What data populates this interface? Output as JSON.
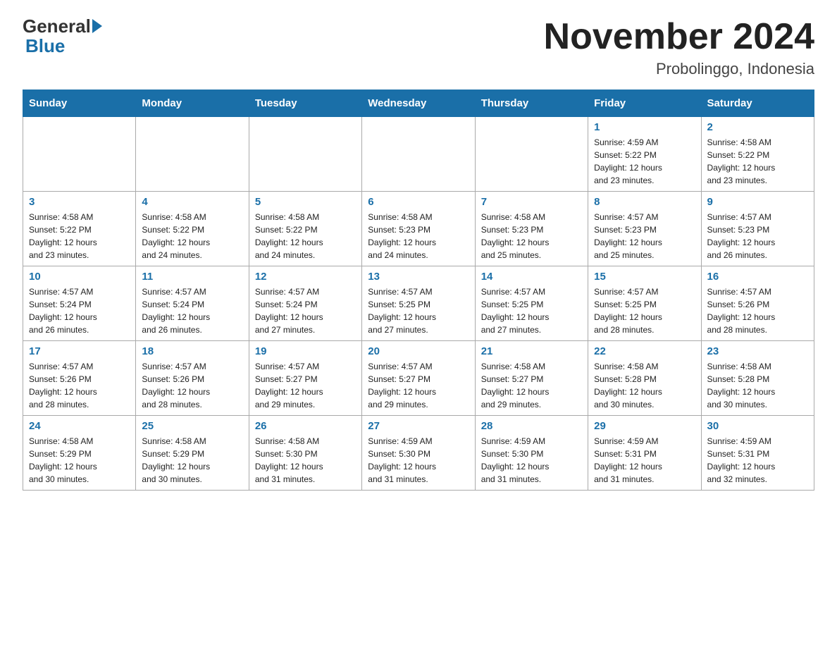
{
  "header": {
    "logo_general": "General",
    "logo_blue": "Blue",
    "month_title": "November 2024",
    "location": "Probolinggo, Indonesia"
  },
  "days_of_week": [
    "Sunday",
    "Monday",
    "Tuesday",
    "Wednesday",
    "Thursday",
    "Friday",
    "Saturday"
  ],
  "weeks": [
    [
      {
        "day": "",
        "info": ""
      },
      {
        "day": "",
        "info": ""
      },
      {
        "day": "",
        "info": ""
      },
      {
        "day": "",
        "info": ""
      },
      {
        "day": "",
        "info": ""
      },
      {
        "day": "1",
        "info": "Sunrise: 4:59 AM\nSunset: 5:22 PM\nDaylight: 12 hours\nand 23 minutes."
      },
      {
        "day": "2",
        "info": "Sunrise: 4:58 AM\nSunset: 5:22 PM\nDaylight: 12 hours\nand 23 minutes."
      }
    ],
    [
      {
        "day": "3",
        "info": "Sunrise: 4:58 AM\nSunset: 5:22 PM\nDaylight: 12 hours\nand 23 minutes."
      },
      {
        "day": "4",
        "info": "Sunrise: 4:58 AM\nSunset: 5:22 PM\nDaylight: 12 hours\nand 24 minutes."
      },
      {
        "day": "5",
        "info": "Sunrise: 4:58 AM\nSunset: 5:22 PM\nDaylight: 12 hours\nand 24 minutes."
      },
      {
        "day": "6",
        "info": "Sunrise: 4:58 AM\nSunset: 5:23 PM\nDaylight: 12 hours\nand 24 minutes."
      },
      {
        "day": "7",
        "info": "Sunrise: 4:58 AM\nSunset: 5:23 PM\nDaylight: 12 hours\nand 25 minutes."
      },
      {
        "day": "8",
        "info": "Sunrise: 4:57 AM\nSunset: 5:23 PM\nDaylight: 12 hours\nand 25 minutes."
      },
      {
        "day": "9",
        "info": "Sunrise: 4:57 AM\nSunset: 5:23 PM\nDaylight: 12 hours\nand 26 minutes."
      }
    ],
    [
      {
        "day": "10",
        "info": "Sunrise: 4:57 AM\nSunset: 5:24 PM\nDaylight: 12 hours\nand 26 minutes."
      },
      {
        "day": "11",
        "info": "Sunrise: 4:57 AM\nSunset: 5:24 PM\nDaylight: 12 hours\nand 26 minutes."
      },
      {
        "day": "12",
        "info": "Sunrise: 4:57 AM\nSunset: 5:24 PM\nDaylight: 12 hours\nand 27 minutes."
      },
      {
        "day": "13",
        "info": "Sunrise: 4:57 AM\nSunset: 5:25 PM\nDaylight: 12 hours\nand 27 minutes."
      },
      {
        "day": "14",
        "info": "Sunrise: 4:57 AM\nSunset: 5:25 PM\nDaylight: 12 hours\nand 27 minutes."
      },
      {
        "day": "15",
        "info": "Sunrise: 4:57 AM\nSunset: 5:25 PM\nDaylight: 12 hours\nand 28 minutes."
      },
      {
        "day": "16",
        "info": "Sunrise: 4:57 AM\nSunset: 5:26 PM\nDaylight: 12 hours\nand 28 minutes."
      }
    ],
    [
      {
        "day": "17",
        "info": "Sunrise: 4:57 AM\nSunset: 5:26 PM\nDaylight: 12 hours\nand 28 minutes."
      },
      {
        "day": "18",
        "info": "Sunrise: 4:57 AM\nSunset: 5:26 PM\nDaylight: 12 hours\nand 28 minutes."
      },
      {
        "day": "19",
        "info": "Sunrise: 4:57 AM\nSunset: 5:27 PM\nDaylight: 12 hours\nand 29 minutes."
      },
      {
        "day": "20",
        "info": "Sunrise: 4:57 AM\nSunset: 5:27 PM\nDaylight: 12 hours\nand 29 minutes."
      },
      {
        "day": "21",
        "info": "Sunrise: 4:58 AM\nSunset: 5:27 PM\nDaylight: 12 hours\nand 29 minutes."
      },
      {
        "day": "22",
        "info": "Sunrise: 4:58 AM\nSunset: 5:28 PM\nDaylight: 12 hours\nand 30 minutes."
      },
      {
        "day": "23",
        "info": "Sunrise: 4:58 AM\nSunset: 5:28 PM\nDaylight: 12 hours\nand 30 minutes."
      }
    ],
    [
      {
        "day": "24",
        "info": "Sunrise: 4:58 AM\nSunset: 5:29 PM\nDaylight: 12 hours\nand 30 minutes."
      },
      {
        "day": "25",
        "info": "Sunrise: 4:58 AM\nSunset: 5:29 PM\nDaylight: 12 hours\nand 30 minutes."
      },
      {
        "day": "26",
        "info": "Sunrise: 4:58 AM\nSunset: 5:30 PM\nDaylight: 12 hours\nand 31 minutes."
      },
      {
        "day": "27",
        "info": "Sunrise: 4:59 AM\nSunset: 5:30 PM\nDaylight: 12 hours\nand 31 minutes."
      },
      {
        "day": "28",
        "info": "Sunrise: 4:59 AM\nSunset: 5:30 PM\nDaylight: 12 hours\nand 31 minutes."
      },
      {
        "day": "29",
        "info": "Sunrise: 4:59 AM\nSunset: 5:31 PM\nDaylight: 12 hours\nand 31 minutes."
      },
      {
        "day": "30",
        "info": "Sunrise: 4:59 AM\nSunset: 5:31 PM\nDaylight: 12 hours\nand 32 minutes."
      }
    ]
  ]
}
